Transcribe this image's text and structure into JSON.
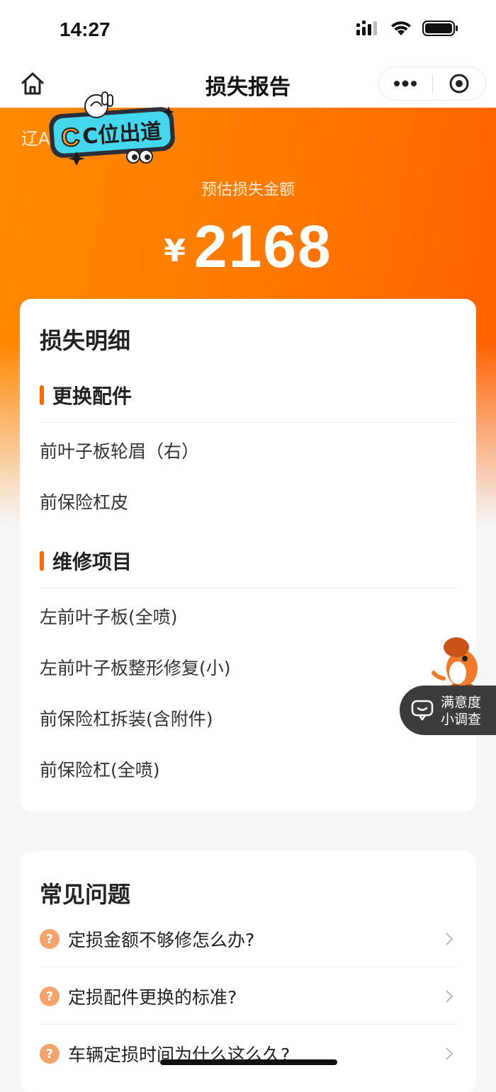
{
  "status_bar": {
    "time": "14:27"
  },
  "nav": {
    "title": "损失报告"
  },
  "hero": {
    "plate_prefix": "辽A",
    "sticker_text": "C位出道",
    "label": "预估损失金额",
    "currency": "¥",
    "amount": "2168"
  },
  "loss_detail": {
    "title": "损失明细",
    "sections": [
      {
        "title": "更换配件",
        "items": [
          "前叶子板轮眉（右）",
          "前保险杠皮"
        ]
      },
      {
        "title": "维修项目",
        "items": [
          "左前叶子板(全喷)",
          "左前叶子板整形修复(小)",
          "前保险杠拆装(含附件)",
          "前保险杠(全喷)"
        ]
      }
    ]
  },
  "faq": {
    "title": "常见问题",
    "items": [
      "定损金额不够修怎么办?",
      "定损配件更换的标准?",
      "车辆定损时间为什么这么久?"
    ]
  },
  "survey": {
    "line1": "满意度",
    "line2": "小调查"
  },
  "colors": {
    "accent": "#ff6a00",
    "hero_start": "#ff8a00",
    "hero_end": "#ff5e00"
  }
}
